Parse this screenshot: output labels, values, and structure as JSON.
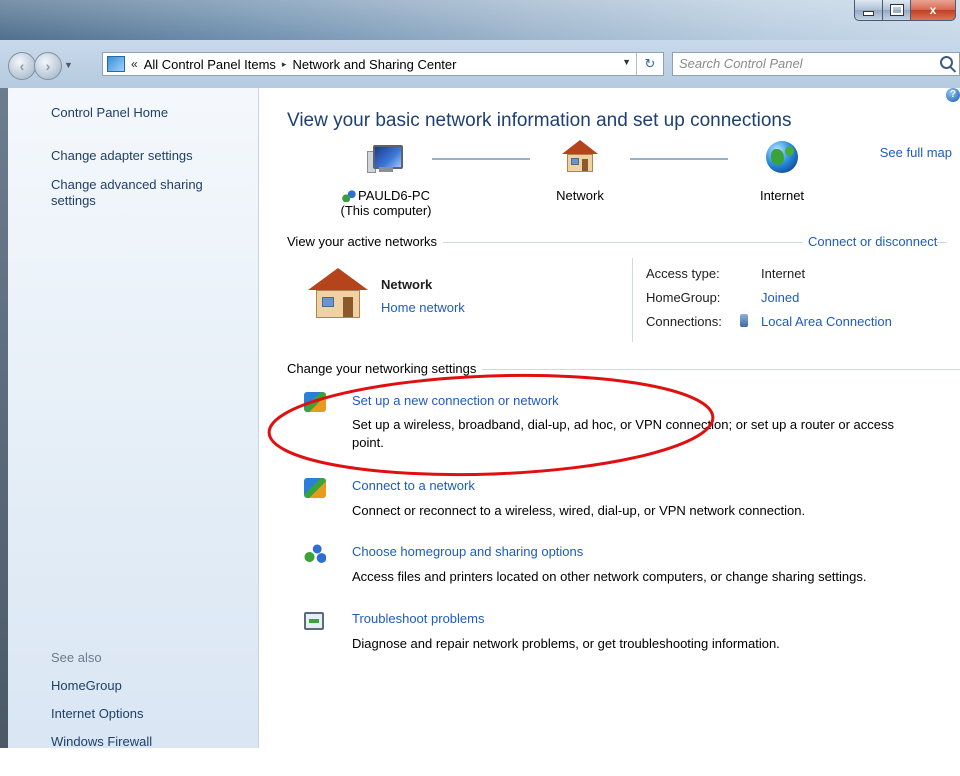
{
  "window": {
    "controls": {
      "close_label": "x"
    }
  },
  "address_bar": {
    "chevron": "«",
    "breadcrumbs": [
      "All Control Panel Items",
      "Network and Sharing Center"
    ],
    "separator": "▸",
    "search_placeholder": "Search Control Panel"
  },
  "sidebar": {
    "top_links": [
      "Control Panel Home",
      "Change adapter settings",
      "Change advanced sharing",
      "settings"
    ],
    "see_also_heading": "See also",
    "see_also_links": [
      "HomeGroup",
      "Internet Options",
      "Windows Firewall"
    ]
  },
  "main": {
    "help_label": "?",
    "title": "View your basic network information and set up connections",
    "see_full_map": "See full map",
    "map": {
      "computer_name": "PAULD6-PC",
      "computer_sub": "(This computer)",
      "network_label": "Network",
      "internet_label": "Internet"
    },
    "active_networks": {
      "heading": "View your active networks",
      "connect_link": "Connect or disconnect",
      "network_name": "Network",
      "network_type": "Home network",
      "access_type_label": "Access type:",
      "access_type_value": "Internet",
      "homegroup_label": "HomeGroup:",
      "homegroup_value": "Joined",
      "connections_label": "Connections:",
      "connections_value": "Local Area Connection"
    },
    "settings": {
      "heading": "Change your networking settings",
      "tasks": [
        {
          "title": "Set up a new connection or network",
          "desc_line1": "Set up a wireless, broadband, dial-up, ad hoc, or VPN connection; or set up a router or access",
          "desc_line2": "point."
        },
        {
          "title": "Connect to a network",
          "desc_line1": "Connect or reconnect to a wireless, wired, dial-up, or VPN network connection."
        },
        {
          "title": "Choose homegroup and sharing options",
          "desc_line1": "Access files and printers located on other network computers, or change sharing settings."
        },
        {
          "title": "Troubleshoot problems",
          "desc_line1": "Diagnose and repair network problems, or get troubleshooting information."
        }
      ]
    }
  },
  "colors": {
    "link": "#1f5bbf",
    "title": "#1e3f73",
    "callout": "#e01010"
  }
}
